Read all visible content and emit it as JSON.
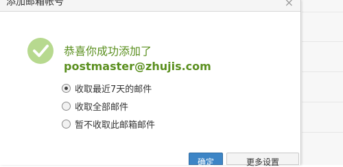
{
  "dialog": {
    "title": "添加邮箱帐号",
    "close_symbol": "×",
    "message_prefix": "恭喜你成功添加了 ",
    "email": "postmaster@zhujis.com",
    "options": [
      {
        "label": "收取最近7天的邮件",
        "checked": true
      },
      {
        "label": "收取全部邮件",
        "checked": false
      },
      {
        "label": "暂不收取此邮箱邮件",
        "checked": false
      }
    ],
    "buttons": {
      "ok": "确定",
      "more": "更多设置"
    }
  },
  "colors": {
    "success_green": "#5a8f1e",
    "icon_green": "#b7d98f",
    "primary_blue": "#3d85c6"
  }
}
